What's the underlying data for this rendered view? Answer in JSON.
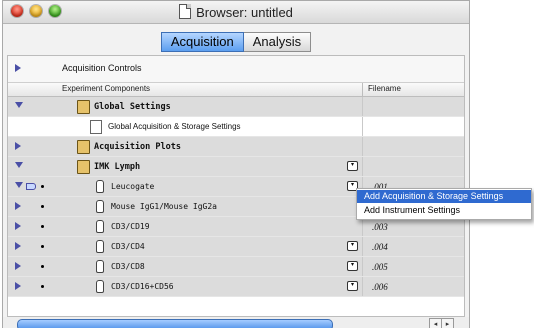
{
  "window": {
    "title": "Browser: untitled"
  },
  "tabs": [
    {
      "label": "Acquisition",
      "selected": true
    },
    {
      "label": "Analysis",
      "selected": false
    }
  ],
  "acquisition_controls": {
    "label": "Acquisition Controls"
  },
  "table": {
    "columns": {
      "components": "Experiment Components",
      "filename": "Filename"
    },
    "rows": [
      {
        "label": "Global Settings",
        "expanded": true,
        "filename": ""
      },
      {
        "label": "Global Acquisition & Storage Settings",
        "filename": ""
      },
      {
        "label": "Acquisition Plots",
        "expanded": false,
        "filename": ""
      },
      {
        "label": "IMK Lymph",
        "expanded": true,
        "filename": ""
      },
      {
        "label": "Leucogate",
        "filename": ".001"
      },
      {
        "label": "Mouse IgG1/Mouse IgG2a",
        "filename": ""
      },
      {
        "label": "CD3/CD19",
        "filename": ".003"
      },
      {
        "label": "CD3/CD4",
        "filename": ".004"
      },
      {
        "label": "CD3/CD8",
        "filename": ".005"
      },
      {
        "label": "CD3/CD16+CD56",
        "filename": ".006"
      }
    ]
  },
  "context_menu": {
    "items": [
      {
        "label": "Add Acquisition & Storage Settings",
        "highlighted": true
      },
      {
        "label": "Add Instrument Settings",
        "highlighted": false
      }
    ]
  },
  "colors": {
    "selection": "#2f6ad0",
    "tab_selected": "#5c9ef0",
    "disclosure": "#4a4fa6"
  }
}
